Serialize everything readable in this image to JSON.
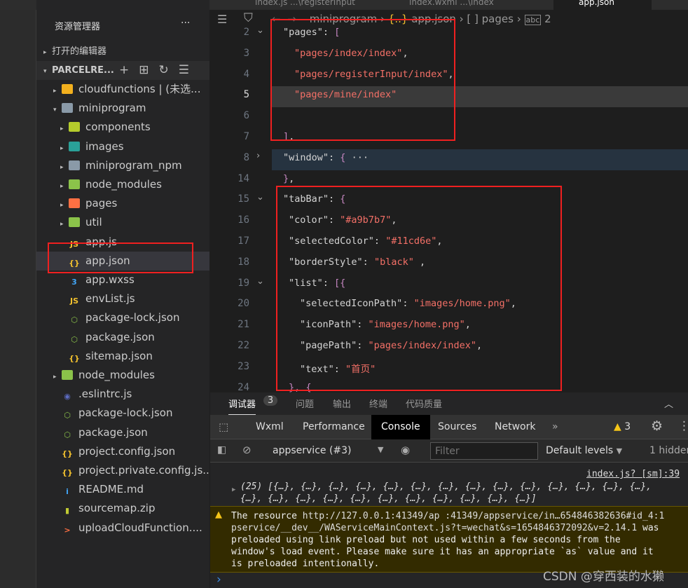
{
  "tabs": [
    "index.js ...\\registerInput",
    "index.wxml ...\\index",
    "app.json"
  ],
  "sidebar": {
    "title": "资源管理器",
    "more": "···",
    "open_editors": "打开的编辑器",
    "project": "PARCELRE...",
    "items": [
      {
        "label": "cloudfunctions | (未选...",
        "depth": 0,
        "arrow": "▸",
        "icon": "folder-cloud-icon",
        "color": "#f2b01e"
      },
      {
        "label": "miniprogram",
        "depth": 0,
        "arrow": "▾",
        "icon": "folder-open-icon",
        "color": "#8a9aa8"
      },
      {
        "label": "components",
        "depth": 1,
        "arrow": "▸",
        "icon": "folder-components-icon",
        "color": "#b5cc2c"
      },
      {
        "label": "images",
        "depth": 1,
        "arrow": "▸",
        "icon": "folder-images-icon",
        "color": "#2aa198"
      },
      {
        "label": "miniprogram_npm",
        "depth": 1,
        "arrow": "▸",
        "icon": "folder-icon",
        "color": "#8a9aa8"
      },
      {
        "label": "node_modules",
        "depth": 1,
        "arrow": "▸",
        "icon": "folder-node-icon",
        "color": "#8bc34a"
      },
      {
        "label": "pages",
        "depth": 1,
        "arrow": "▸",
        "icon": "folder-pages-icon",
        "color": "#ff7043"
      },
      {
        "label": "util",
        "depth": 1,
        "arrow": "▸",
        "icon": "folder-util-icon",
        "color": "#8bc34a"
      },
      {
        "label": "app.js",
        "depth": 1,
        "arrow": "",
        "icon": "js-file-icon",
        "color": "#f2c12e",
        "glyph": "JS"
      },
      {
        "label": "app.json",
        "depth": 1,
        "arrow": "",
        "icon": "json-file-icon",
        "color": "#f2c12e",
        "glyph": "{}",
        "selected": true
      },
      {
        "label": "app.wxss",
        "depth": 1,
        "arrow": "",
        "icon": "css-file-icon",
        "color": "#42a5f5",
        "glyph": "3"
      },
      {
        "label": "envList.js",
        "depth": 1,
        "arrow": "",
        "icon": "js-file-icon",
        "color": "#f2c12e",
        "glyph": "JS"
      },
      {
        "label": "package-lock.json",
        "depth": 1,
        "arrow": "",
        "icon": "nodejs-file-icon",
        "color": "#8bc34a",
        "glyph": "⬡"
      },
      {
        "label": "package.json",
        "depth": 1,
        "arrow": "",
        "icon": "nodejs-file-icon",
        "color": "#8bc34a",
        "glyph": "⬡"
      },
      {
        "label": "sitemap.json",
        "depth": 1,
        "arrow": "",
        "icon": "json-file-icon",
        "color": "#f2c12e",
        "glyph": "{}"
      },
      {
        "label": "node_modules",
        "depth": 0,
        "arrow": "▸",
        "icon": "folder-node-icon",
        "color": "#8bc34a"
      },
      {
        "label": ".eslintrc.js",
        "depth": 0,
        "arrow": "",
        "icon": "eslint-file-icon",
        "color": "#5c6bc0",
        "glyph": "◉"
      },
      {
        "label": "package-lock.json",
        "depth": 0,
        "arrow": "",
        "icon": "nodejs-file-icon",
        "color": "#8bc34a",
        "glyph": "⬡"
      },
      {
        "label": "package.json",
        "depth": 0,
        "arrow": "",
        "icon": "nodejs-file-icon",
        "color": "#8bc34a",
        "glyph": "⬡"
      },
      {
        "label": "project.config.json",
        "depth": 0,
        "arrow": "",
        "icon": "json-file-icon",
        "color": "#f2c12e",
        "glyph": "{}"
      },
      {
        "label": "project.private.config.js...",
        "depth": 0,
        "arrow": "",
        "icon": "json-file-icon",
        "color": "#f2c12e",
        "glyph": "{}"
      },
      {
        "label": "README.md",
        "depth": 0,
        "arrow": "",
        "icon": "info-file-icon",
        "color": "#42a5f5",
        "glyph": "i"
      },
      {
        "label": "sourcemap.zip",
        "depth": 0,
        "arrow": "",
        "icon": "zip-file-icon",
        "color": "#c0ca33",
        "glyph": "▮"
      },
      {
        "label": "uploadCloudFunction....",
        "depth": 0,
        "arrow": "",
        "icon": "shell-file-icon",
        "color": "#ff7043",
        "glyph": ">"
      }
    ]
  },
  "breadcrumb": [
    "miniprogram",
    "app.json",
    "[ ] pages",
    "2"
  ],
  "code": [
    {
      "n": "2",
      "fold": "v",
      "ind": 0,
      "parts": [
        [
          "k",
          "\"pages\""
        ],
        [
          "t",
          ": "
        ],
        [
          "p",
          "["
        ]
      ]
    },
    {
      "n": "3",
      "ind": 1,
      "parts": [
        [
          "s",
          "\"pages/index/index\""
        ],
        [
          "t",
          ","
        ]
      ]
    },
    {
      "n": "4",
      "ind": 1,
      "parts": [
        [
          "s",
          "\"pages/registerInput/index\""
        ],
        [
          "t",
          ","
        ]
      ]
    },
    {
      "n": "5",
      "ind": 1,
      "cur": true,
      "parts": [
        [
          "s",
          "\"pages/mine/index\""
        ]
      ]
    },
    {
      "n": "6",
      "ind": 0,
      "parts": []
    },
    {
      "n": "7",
      "ind": 0,
      "parts": [
        [
          "p",
          "]"
        ],
        [
          "t",
          ","
        ]
      ]
    },
    {
      "n": "8",
      "fold": ">",
      "ind": 0,
      "hl": true,
      "parts": [
        [
          "k",
          "\"window\""
        ],
        [
          "t",
          ": "
        ],
        [
          "p",
          "{"
        ],
        [
          "t",
          " ···"
        ]
      ]
    },
    {
      "n": "14",
      "ind": 0,
      "parts": [
        [
          "p",
          "}"
        ],
        [
          "t",
          ","
        ]
      ]
    },
    {
      "n": "15",
      "fold": "v",
      "ind": 0,
      "parts": [
        [
          "k",
          "\"tabBar\""
        ],
        [
          "t",
          ": "
        ],
        [
          "p",
          "{"
        ]
      ]
    },
    {
      "n": "16",
      "ind": 0.5,
      "parts": [
        [
          "k",
          "\"color\""
        ],
        [
          "t",
          ": "
        ],
        [
          "s",
          "\"#a9b7b7\""
        ],
        [
          "t",
          ","
        ]
      ]
    },
    {
      "n": "17",
      "ind": 0.5,
      "parts": [
        [
          "k",
          "\"selectedColor\""
        ],
        [
          "t",
          ": "
        ],
        [
          "s",
          "\"#11cd6e\""
        ],
        [
          "t",
          ","
        ]
      ]
    },
    {
      "n": "18",
      "ind": 0.5,
      "parts": [
        [
          "k",
          "\"borderStyle\""
        ],
        [
          "t",
          ": "
        ],
        [
          "s",
          "\"black\""
        ],
        [
          "t",
          " ,"
        ]
      ]
    },
    {
      "n": "19",
      "fold": "v",
      "ind": 0.5,
      "parts": [
        [
          "k",
          "\"list\""
        ],
        [
          "t",
          ": "
        ],
        [
          "p",
          "[{"
        ]
      ]
    },
    {
      "n": "20",
      "ind": 1.5,
      "parts": [
        [
          "k",
          "\"selectedIconPath\""
        ],
        [
          "t",
          ": "
        ],
        [
          "s",
          "\"images/home.png\""
        ],
        [
          "t",
          ","
        ]
      ]
    },
    {
      "n": "21",
      "ind": 1.5,
      "parts": [
        [
          "k",
          "\"iconPath\""
        ],
        [
          "t",
          ": "
        ],
        [
          "s",
          "\"images/home.png\""
        ],
        [
          "t",
          ","
        ]
      ]
    },
    {
      "n": "22",
      "ind": 1.5,
      "parts": [
        [
          "k",
          "\"pagePath\""
        ],
        [
          "t",
          ": "
        ],
        [
          "s",
          "\"pages/index/index\""
        ],
        [
          "t",
          ","
        ]
      ]
    },
    {
      "n": "23",
      "ind": 1.5,
      "parts": [
        [
          "k",
          "\"text\""
        ],
        [
          "t",
          ": "
        ],
        [
          "s",
          "\"首页\""
        ]
      ]
    },
    {
      "n": "24",
      "ind": 0.5,
      "parts": [
        [
          "p",
          "}, {"
        ]
      ]
    }
  ],
  "panel": {
    "tabs": [
      "调试器",
      "问题",
      "输出",
      "终端",
      "代码质量"
    ],
    "badge": "3",
    "devtools_tabs": [
      "Wxml",
      "Performance",
      "Console",
      "Sources",
      "Network"
    ],
    "more": "»",
    "warn_count": "3",
    "context": "appservice (#3)",
    "filter_placeholder": "Filter",
    "levels": "Default levels",
    "hidden": "1 hidden"
  },
  "console": {
    "log_source": "index.js? [sm]:39",
    "log_line1": "(25) [{…}, {…}, {…}, {…}, {…}, {…}, {…}, {…}, {…}, {…}, {…}, {…}, {…}, {…},",
    "log_line2": "{…}, {…}, {…}, {…}, {…}, {…}, {…}, {…}, {…}, {…}, {…}]",
    "warn_prefix": "The resource ",
    "warn_link1": "http://127.0.0.1:41349/ap",
    "warn_link2": ":41349/appservice/in…654846382636#id_4:1",
    "warn_link3": "pservice/__dev__/WAServiceMainContext.js?t=wechat&s=1654846372092&v=2.14.1",
    "warn_text1": " was",
    "warn_text2": "preloaded using link preload but not used within a few seconds from the",
    "warn_text3": "window's load event. Please make sure it has an appropriate `as` value and it",
    "warn_text4": "is preloaded intentionally.",
    "prompt": "›"
  },
  "watermark": "CSDN @穿西装的水獭"
}
